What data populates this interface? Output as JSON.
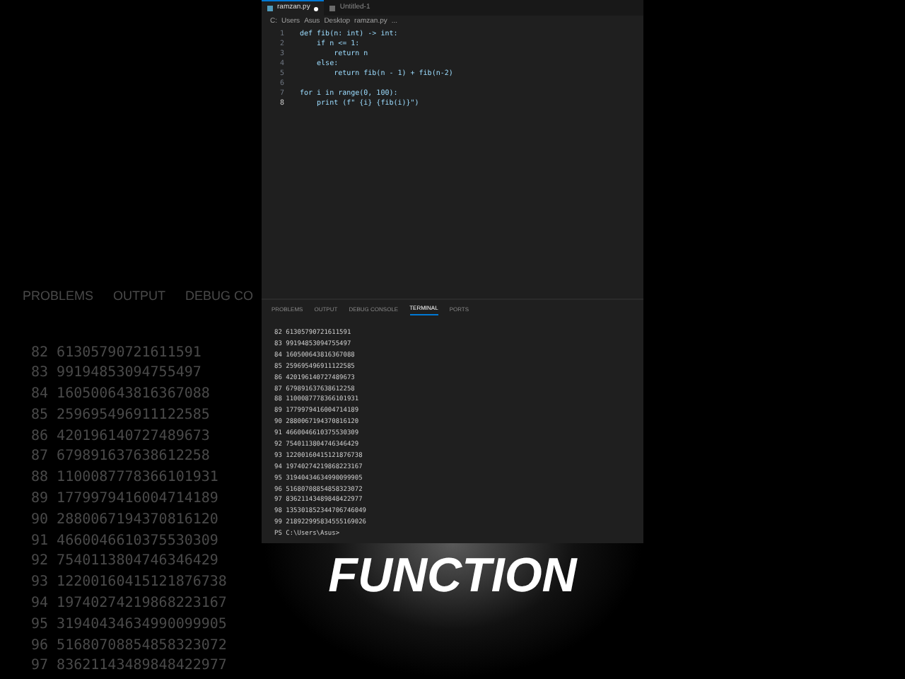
{
  "backdrop": {
    "tabs": [
      "PROBLEMS",
      "OUTPUT",
      "DEBUG CO"
    ],
    "lines": [
      [
        "82",
        "61305790721611591"
      ],
      [
        "83",
        "99194853094755497"
      ],
      [
        "84",
        "160500643816367088"
      ],
      [
        "85",
        "259695496911122585"
      ],
      [
        "86",
        "420196140727489673"
      ],
      [
        "87",
        "679891637638612258"
      ],
      [
        "88",
        "1100087778366101931"
      ],
      [
        "89",
        "1779979416004714189"
      ],
      [
        "90",
        "2880067194370816120"
      ],
      [
        "91",
        "4660046610375530309"
      ],
      [
        "92",
        "7540113804746346429"
      ],
      [
        "93",
        "12200160415121876738"
      ],
      [
        "94",
        "19740274219868223167"
      ],
      [
        "95",
        "31940434634990099905"
      ],
      [
        "96",
        "51680708854858323072"
      ],
      [
        "97",
        "83621143489848422977"
      ]
    ]
  },
  "editor_tabs": [
    {
      "label": "ramzan.py",
      "selected": true,
      "modified": true
    },
    {
      "label": "Untitled-1",
      "selected": false,
      "modified": false
    }
  ],
  "breadcrumb": [
    "C:",
    "Users",
    "Asus",
    "Desktop",
    "ramzan.py",
    "..."
  ],
  "code": [
    {
      "number": "1",
      "text": "def fib(n: int) -> int:"
    },
    {
      "number": "2",
      "text": "    if n <= 1:"
    },
    {
      "number": "3",
      "text": "        return n"
    },
    {
      "number": "4",
      "text": "    else:"
    },
    {
      "number": "5",
      "text": "        return fib(n - 1) + fib(n-2)"
    },
    {
      "number": "6"
    },
    {
      "number": "7",
      "text": "for i in range(0, 100):"
    },
    {
      "number": "8",
      "text": "    print (f\" {i} {fib(i)}\")"
    }
  ],
  "panel_tabs": [
    {
      "label": "PROBLEMS",
      "selected": false
    },
    {
      "label": "OUTPUT",
      "selected": false
    },
    {
      "label": "DEBUG CONSOLE",
      "selected": false
    },
    {
      "label": "TERMINAL",
      "selected": true
    },
    {
      "label": "PORTS",
      "selected": false
    }
  ],
  "terminal": [
    "82 61305790721611591",
    "83 99194853094755497",
    "84 160500643816367088",
    "85 259695496911122585",
    "86 420196140727489673",
    "87 679891637638612258",
    "88 1100087778366101931",
    "89 1779979416004714189",
    "90 2880067194370816120",
    "91 4660046610375530309",
    "92 7540113804746346429",
    "93 12200160415121876738",
    "94 19740274219868223167",
    "95 31940434634990099905",
    "96 51680708854858323072",
    "97 83621143489848422977",
    "98 135301852344706746049",
    "99 218922995834555169026",
    "PS C:\\Users\\Asus>"
  ],
  "caption": "FUNCTION"
}
